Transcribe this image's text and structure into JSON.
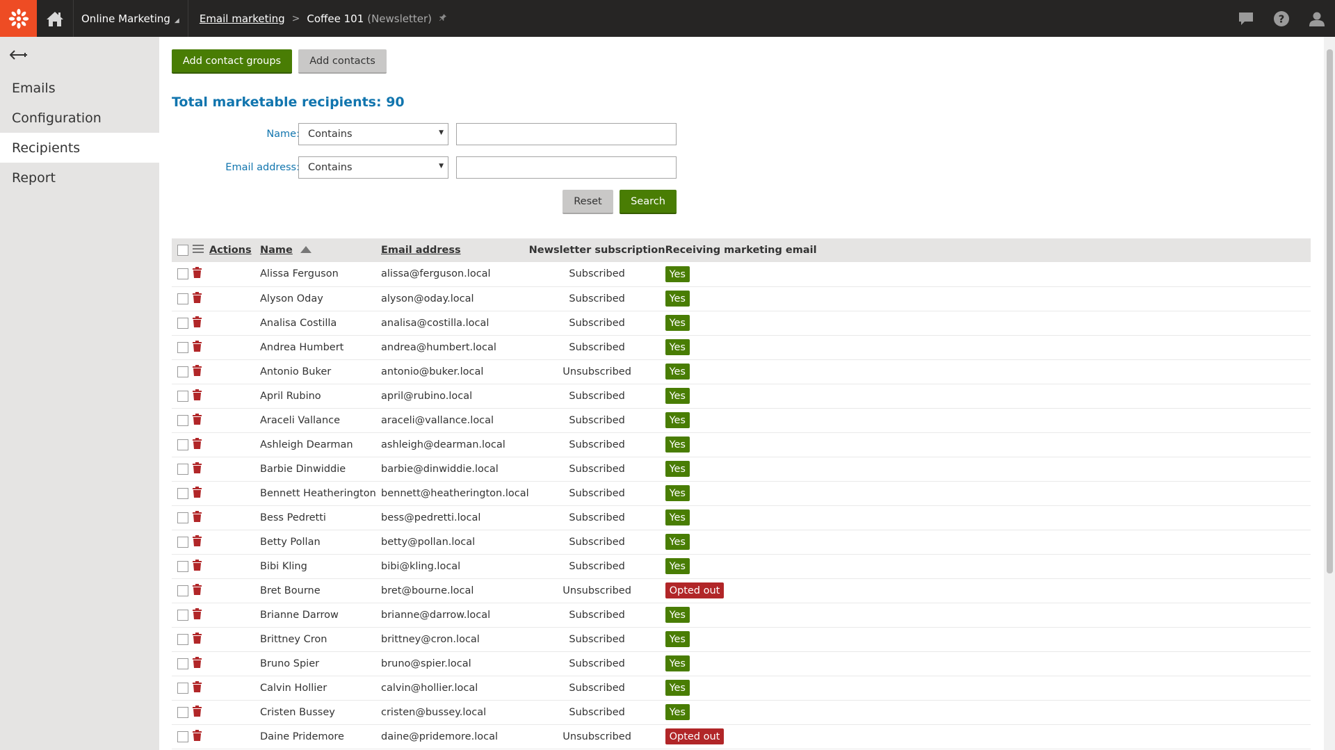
{
  "header": {
    "app_name": "Online Marketing",
    "breadcrumb_link": "Email marketing",
    "breadcrumb_current": "Coffee 101",
    "breadcrumb_type": "(Newsletter)"
  },
  "sidebar": {
    "items": [
      {
        "label": "Emails"
      },
      {
        "label": "Configuration"
      },
      {
        "label": "Recipients"
      },
      {
        "label": "Report"
      }
    ],
    "active": "Recipients"
  },
  "toolbar": {
    "add_groups_label": "Add contact groups",
    "add_contacts_label": "Add contacts"
  },
  "total_label": "Total marketable recipients: 90",
  "filter": {
    "name_label": "Name:",
    "name_operator": "Contains",
    "name_value": "",
    "email_label": "Email address:",
    "email_operator": "Contains",
    "email_value": "",
    "reset_label": "Reset",
    "search_label": "Search"
  },
  "table": {
    "headers": {
      "actions": "Actions",
      "name": "Name",
      "email": "Email address",
      "subscription": "Newsletter subscription",
      "receiving": "Receiving marketing email"
    },
    "sort": {
      "column": "Name",
      "direction": "ascending"
    },
    "rows": [
      {
        "name": "Alissa Ferguson",
        "email": "alissa@ferguson.local",
        "subscription": "Subscribed",
        "receiving": "Yes"
      },
      {
        "name": "Alyson Oday",
        "email": "alyson@oday.local",
        "subscription": "Subscribed",
        "receiving": "Yes"
      },
      {
        "name": "Analisa Costilla",
        "email": "analisa@costilla.local",
        "subscription": "Subscribed",
        "receiving": "Yes"
      },
      {
        "name": "Andrea Humbert",
        "email": "andrea@humbert.local",
        "subscription": "Subscribed",
        "receiving": "Yes"
      },
      {
        "name": "Antonio Buker",
        "email": "antonio@buker.local",
        "subscription": "Unsubscribed",
        "receiving": "Yes"
      },
      {
        "name": "April Rubino",
        "email": "april@rubino.local",
        "subscription": "Subscribed",
        "receiving": "Yes"
      },
      {
        "name": "Araceli Vallance",
        "email": "araceli@vallance.local",
        "subscription": "Subscribed",
        "receiving": "Yes"
      },
      {
        "name": "Ashleigh Dearman",
        "email": "ashleigh@dearman.local",
        "subscription": "Subscribed",
        "receiving": "Yes"
      },
      {
        "name": "Barbie Dinwiddie",
        "email": "barbie@dinwiddie.local",
        "subscription": "Subscribed",
        "receiving": "Yes"
      },
      {
        "name": "Bennett Heatherington",
        "email": "bennett@heatherington.local",
        "subscription": "Subscribed",
        "receiving": "Yes"
      },
      {
        "name": "Bess Pedretti",
        "email": "bess@pedretti.local",
        "subscription": "Subscribed",
        "receiving": "Yes"
      },
      {
        "name": "Betty Pollan",
        "email": "betty@pollan.local",
        "subscription": "Subscribed",
        "receiving": "Yes"
      },
      {
        "name": "Bibi Kling",
        "email": "bibi@kling.local",
        "subscription": "Subscribed",
        "receiving": "Yes"
      },
      {
        "name": "Bret Bourne",
        "email": "bret@bourne.local",
        "subscription": "Unsubscribed",
        "receiving": "Opted out"
      },
      {
        "name": "Brianne Darrow",
        "email": "brianne@darrow.local",
        "subscription": "Subscribed",
        "receiving": "Yes"
      },
      {
        "name": "Brittney Cron",
        "email": "brittney@cron.local",
        "subscription": "Subscribed",
        "receiving": "Yes"
      },
      {
        "name": "Bruno Spier",
        "email": "bruno@spier.local",
        "subscription": "Subscribed",
        "receiving": "Yes"
      },
      {
        "name": "Calvin Hollier",
        "email": "calvin@hollier.local",
        "subscription": "Subscribed",
        "receiving": "Yes"
      },
      {
        "name": "Cristen Bussey",
        "email": "cristen@bussey.local",
        "subscription": "Subscribed",
        "receiving": "Yes"
      },
      {
        "name": "Daine Pridemore",
        "email": "daine@pridemore.local",
        "subscription": "Unsubscribed",
        "receiving": "Opted out"
      }
    ]
  },
  "colors": {
    "brand": "#ee4c24",
    "topbar": "#262524",
    "accent_blue": "#1175ae",
    "green": "#497d04",
    "red": "#b12628",
    "delete_icon": "#b12628"
  },
  "icons": {
    "logo": "kentico-logo-icon",
    "home": "home-icon",
    "chat": "chat-icon",
    "help": "help-icon",
    "user": "user-icon",
    "back": "back-arrow-icon",
    "delete": "trash-icon",
    "sort": "sort-ascending-icon",
    "menu": "column-menu-icon",
    "pin": "pin-icon"
  }
}
